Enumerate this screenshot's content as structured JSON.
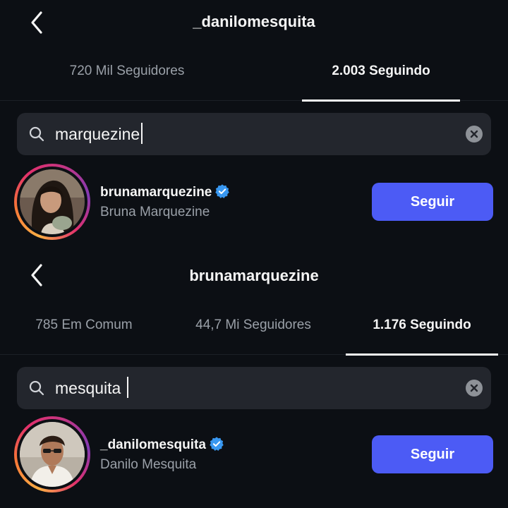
{
  "top": {
    "title": "_danilomesquita",
    "tabs": [
      {
        "label": "720 Mil Seguidores",
        "active": false
      },
      {
        "label": "2.003 Seguindo",
        "active": true
      }
    ],
    "search": {
      "query": "marquezine"
    },
    "result": {
      "username": "brunamarquezine",
      "full_name": "Bruna Marquezine",
      "verified": true,
      "button_label": "Seguir"
    }
  },
  "bottom": {
    "title": "brunamarquezine",
    "tabs": [
      {
        "label": "785 Em Comum",
        "active": false
      },
      {
        "label": "44,7 Mi Seguidores",
        "active": false
      },
      {
        "label": "1.176 Seguindo",
        "active": true
      }
    ],
    "search": {
      "query": "mesquita"
    },
    "result": {
      "username": "_danilomesquita",
      "full_name": "Danilo Mesquita",
      "verified": true,
      "button_label": "Seguir"
    }
  },
  "colors": {
    "background": "#0c0f14",
    "search_bg": "#23262d",
    "follow_button": "#4c5bf5",
    "verified_badge": "#3897f0",
    "muted_text": "#9aa0a8"
  }
}
